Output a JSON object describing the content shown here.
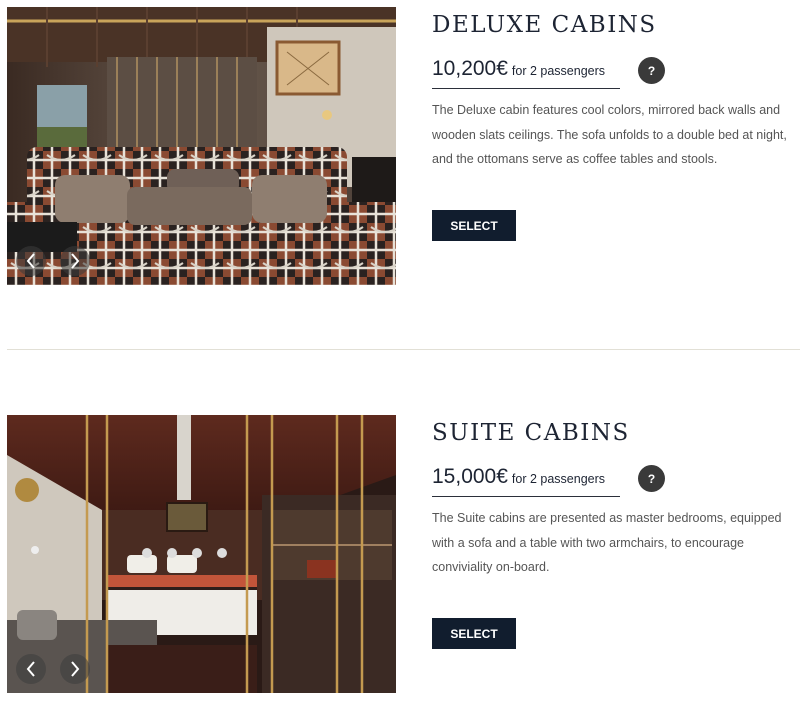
{
  "cabins": [
    {
      "title": "DELUXE CABINS",
      "price": "10,200€",
      "price_suffix": "for 2 passengers",
      "help_label": "?",
      "description": "The Deluxe cabin features cool colors, mirrored back walls and wooden slats ceilings. The sofa unfolds to a double bed at night, and the ottomans serve as coffee tables and stools.",
      "select_label": "SELECT",
      "photo_icon": "deluxe-cabin-photo",
      "prev_icon": "chevron-left-icon",
      "next_icon": "chevron-right-icon"
    },
    {
      "title": "SUITE CABINS",
      "price": "15,000€",
      "price_suffix": "for 2 passengers",
      "help_label": "?",
      "description": "The Suite cabins are presented as master bedrooms, equipped with a sofa and a table with two armchairs, to encourage conviviality on-board.",
      "select_label": "SELECT",
      "photo_icon": "suite-cabin-photo",
      "prev_icon": "chevron-left-icon",
      "next_icon": "chevron-right-icon"
    }
  ],
  "colors": {
    "title": "#1d2433",
    "button_bg": "#111d2e",
    "button_text": "#ffffff",
    "help_bg": "#3a3a3a",
    "divider": "#e2e0d6",
    "body_text": "#555555"
  }
}
